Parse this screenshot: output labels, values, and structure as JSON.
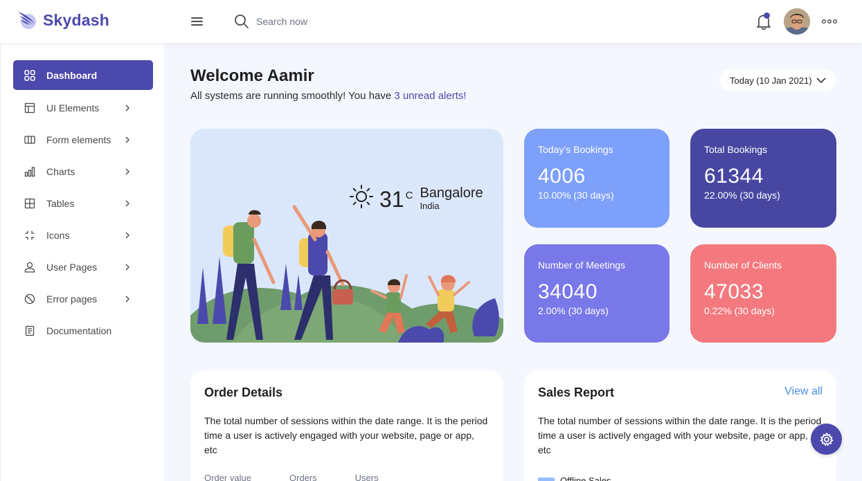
{
  "brand": {
    "name": "Skydash"
  },
  "search": {
    "placeholder": "Search now"
  },
  "sidebar": {
    "items": [
      {
        "label": "Dashboard",
        "icon": "grid-icon",
        "active": true,
        "has_submenu": false
      },
      {
        "label": "UI Elements",
        "icon": "layout-icon",
        "active": false,
        "has_submenu": true
      },
      {
        "label": "Form elements",
        "icon": "columns-icon",
        "active": false,
        "has_submenu": true
      },
      {
        "label": "Charts",
        "icon": "bar-chart-icon",
        "active": false,
        "has_submenu": true
      },
      {
        "label": "Tables",
        "icon": "table-icon",
        "active": false,
        "has_submenu": true
      },
      {
        "label": "Icons",
        "icon": "focus-icon",
        "active": false,
        "has_submenu": true
      },
      {
        "label": "User Pages",
        "icon": "user-icon",
        "active": false,
        "has_submenu": true
      },
      {
        "label": "Error pages",
        "icon": "ban-icon",
        "active": false,
        "has_submenu": true
      },
      {
        "label": "Documentation",
        "icon": "document-icon",
        "active": false,
        "has_submenu": false
      }
    ]
  },
  "welcome": {
    "title": "Welcome Aamir",
    "subtitle_prefix": "All systems are running smoothly! You have ",
    "subtitle_link": "3 unread alerts!",
    "date_label": "Today (10 Jan 2021)"
  },
  "weather": {
    "temp": "31",
    "unit": "C",
    "city": "Bangalore",
    "country": "India"
  },
  "stats": [
    {
      "title": "Today’s Bookings",
      "value": "4006",
      "change": "10.00% (30 days)",
      "color": "#7da0fa"
    },
    {
      "title": "Total Bookings",
      "value": "61344",
      "change": "22.00% (30 days)",
      "color": "#4747a1"
    },
    {
      "title": "Number of Meetings",
      "value": "34040",
      "change": "2.00% (30 days)",
      "color": "#7978e9"
    },
    {
      "title": "Number of Clients",
      "value": "47033",
      "change": "0.22% (30 days)",
      "color": "#f3797e"
    }
  ],
  "order_details": {
    "title": "Order Details",
    "description": "The total number of sessions within the date range. It is the period time a user is actively engaged with your website, page or app, etc",
    "labels": [
      "Order value",
      "Orders",
      "Users"
    ]
  },
  "sales_report": {
    "title": "Sales Report",
    "view_all": "View all",
    "description": "The total number of sessions within the date range. It is the period time a user is actively engaged with your website, page or app, etc",
    "legend": [
      "Offline Sales"
    ]
  },
  "colors": {
    "primary": "#4b49ac",
    "link": "#4b8ee0",
    "background": "#f4f7fd"
  }
}
